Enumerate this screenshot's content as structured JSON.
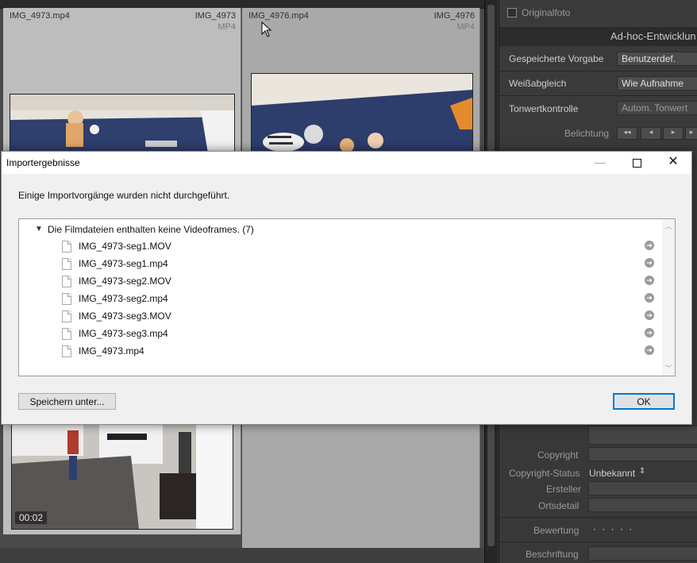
{
  "grid": {
    "cells": [
      {
        "filename": "IMG_4973.mp4",
        "short_name": "IMG_4973",
        "type": "MP4"
      },
      {
        "filename": "IMG_4976.mp4",
        "short_name": "IMG_4976",
        "type": "MP4"
      }
    ],
    "video_duration": "00:02"
  },
  "right_panel": {
    "original_photo_label": "Originalfoto",
    "section_title": "Ad-hoc-Entwicklun",
    "saved_preset_label": "Gespeicherte Vorgabe",
    "saved_preset_value": "Benutzerdef.",
    "white_balance_label": "Weißabgleich",
    "white_balance_value": "Wie Aufnahme",
    "tone_control_label": "Tonwertkontrolle",
    "tone_control_value": "Autom. Tonwert",
    "exposure_label": "Belichtung",
    "copyright_label": "Copyright",
    "copyright_status_label": "Copyright-Status",
    "copyright_status_value": "Unbekannt",
    "creator_label": "Ersteller",
    "location_label": "Ortsdetail",
    "rating_label": "Bewertung",
    "rating_value": "· · · · ·",
    "caption_label": "Beschriftung"
  },
  "dialog": {
    "title": "Importergebnisse",
    "message": "Einige Importvorgänge wurden nicht durchgeführt.",
    "group_label": "Die Filmdateien enthalten keine Videoframes. (7)",
    "files": [
      "IMG_4973-seg1.MOV",
      "IMG_4973-seg1.mp4",
      "IMG_4973-seg2.MOV",
      "IMG_4973-seg2.mp4",
      "IMG_4973-seg3.MOV",
      "IMG_4973-seg3.mp4",
      "IMG_4973.mp4"
    ],
    "save_button": "Speichern unter...",
    "ok_button": "OK"
  }
}
